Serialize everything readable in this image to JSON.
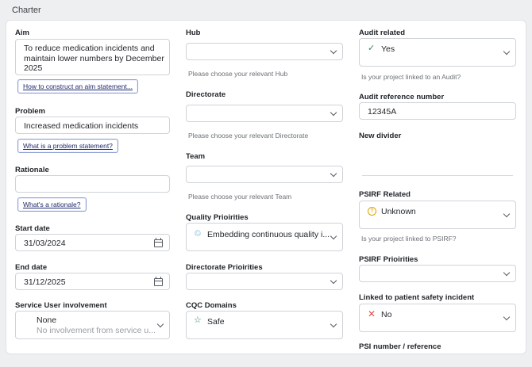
{
  "header": {
    "title": "Charter"
  },
  "colors": {
    "check": "#2e8b57",
    "cross": "#d9534f",
    "warn": "#e0a100",
    "link_border": "#8c9fd6"
  },
  "left": {
    "aim": {
      "label": "Aim",
      "value": "To reduce medication incidents and maintain lower numbers by December 2025",
      "help_link": "How to construct an aim statement..."
    },
    "problem": {
      "label": "Problem",
      "value": "Increased medication incidents",
      "help_link": "What is a problem statement?"
    },
    "rationale": {
      "label": "Rationale",
      "value": "",
      "help_link": "What's a rationale?"
    },
    "start_date": {
      "label": "Start date",
      "value": "31/03/2024",
      "icon": "calendar-icon"
    },
    "end_date": {
      "label": "End date",
      "value": "31/12/2025",
      "icon": "calendar-icon"
    },
    "service_user": {
      "label": "Service User involvement",
      "value": "None",
      "subvalue": "No involvement from service u..."
    }
  },
  "middle": {
    "hub": {
      "label": "Hub",
      "value": "",
      "help": "Please choose your relevant Hub"
    },
    "directorate": {
      "label": "Directorate",
      "value": "",
      "help": "Please choose your relevant Directorate"
    },
    "team": {
      "label": "Team",
      "value": "",
      "help": "Please choose your relevant Team"
    },
    "quality_priorities": {
      "label": "Quality Prioirities",
      "value": "Embedding continuous quality i...",
      "icon": "recycle-icon"
    },
    "directorate_priorities": {
      "label": "Directorate Prioirities",
      "value": ""
    },
    "cqc_domains": {
      "label": "CQC Domains",
      "value": "Safe",
      "icon": "star-icon"
    }
  },
  "right": {
    "audit_related": {
      "label": "Audit related",
      "value": "Yes",
      "icon": "check-icon",
      "help": "Is your project linked to an Audit?"
    },
    "audit_ref": {
      "label": "Audit reference number",
      "value": "12345A"
    },
    "new_divider": {
      "label": "New divider"
    },
    "psirf_related": {
      "label": "PSIRF Related",
      "value": "Unknown",
      "icon": "question-circle-icon",
      "help": "Is your project linked to PSIRF?"
    },
    "psirf_priorities": {
      "label": "PSIRF Prioirities",
      "value": ""
    },
    "linked_incident": {
      "label": "Linked to patient safety incident",
      "value": "No",
      "icon": "cross-icon"
    },
    "psi_number": {
      "label": "PSI number / reference"
    }
  }
}
